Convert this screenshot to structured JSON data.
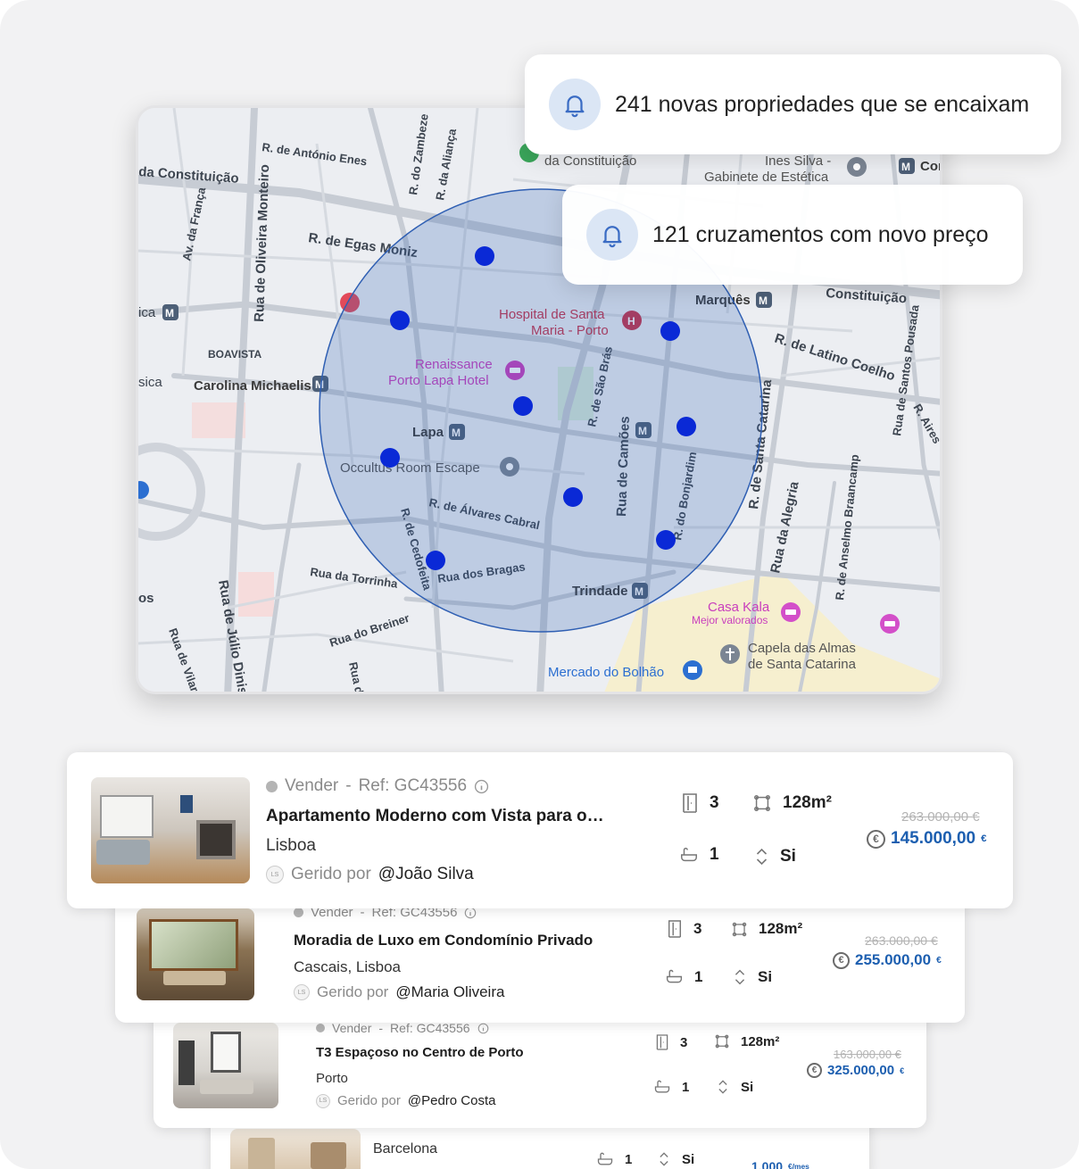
{
  "notifications": [
    {
      "icon": "bell-icon",
      "text": "241 novas propriedades que se encaixam"
    },
    {
      "icon": "bell-icon",
      "text": "121 cruzamentos com novo preço"
    }
  ],
  "map": {
    "streets": {
      "antonio_enes": "R. de António Enes",
      "zambeze": "R. do Zambeze",
      "alianca": "R. da Aliança",
      "constituicao_left": "da Constituição",
      "constituicao_top": "da Constituição",
      "constituicao_right": "Constituição",
      "egas_moniz": "R. de Egas Moniz",
      "franca": "Av. da França",
      "oliveira_monteiro": "Rua de Oliveira Monteiro",
      "boavista": "BOAVISTA",
      "latino_coelho": "R. de Latino Coelho",
      "santos_pousada": "Rua de Santos Pousada",
      "aires": "R. Aires",
      "sao_bras": "R. de São Brás",
      "camoes": "Rua de Camões",
      "bonjardim": "R. do Bonjardim",
      "santa_catarina": "R. de Santa Catarina",
      "alvares_cabral": "R. de Álvares Cabral",
      "cedofeita": "R. de Cedofeita",
      "bragas": "Rua dos Bragas",
      "torrinha": "Rua da Torrinha",
      "breiner": "Rua do Breiner",
      "julio_dinis": "Rua de Júlio Dinis",
      "vilar": "Rua de Vilar",
      "alegria": "Rua da Alegria",
      "anselmo": "R. de Anselmo Braancamp",
      "breiner2": "Rua do",
      "sica": "sica",
      "ica": "ica",
      "os": "os"
    },
    "places": {
      "hospital": "Hospital de Santa",
      "hospital2": "Maria - Porto",
      "renaissance": "Renaissance",
      "renaissance2": "Porto Lapa Hotel",
      "carolina": "Carolina Michaelis",
      "lapa": "Lapa",
      "occultus": "Occultus Room Escape",
      "trindade": "Trindade",
      "marques": "Marquês",
      "ines": "Ines Silva -",
      "ines2": "Gabinete de Estética",
      "casa_kala": "Casa Kala",
      "casa_kala_sub": "Mejor valorados",
      "capela": "Capela das Almas",
      "capela2": "de Santa Catarina",
      "mercado": "Mercado do Bolhão",
      "con": "Con"
    },
    "search_radius_color": "#2f5fb3",
    "pin_color": "#0a29d6"
  },
  "listings": [
    {
      "status": "Vender",
      "sep": "-",
      "ref": "Ref: GC43556",
      "title": "Apartamento Moderno com Vista para o…",
      "location": "Lisboa",
      "managed_label": "Gerido por",
      "manager": "@João Silva",
      "initials": "LS",
      "rooms": "3",
      "area": "128m²",
      "baths": "1",
      "elevator": "Si",
      "old_price": "263.000,00 €",
      "price": "145.000,00",
      "currency": "€"
    },
    {
      "status": "Vender",
      "sep": "-",
      "ref": "Ref: GC43556",
      "title": "Moradia de Luxo em Condomínio Privado",
      "location": "Cascais, Lisboa",
      "managed_label": "Gerido por",
      "manager": "@Maria Oliveira",
      "initials": "LS",
      "rooms": "3",
      "area": "128m²",
      "baths": "1",
      "elevator": "Si",
      "old_price": "263.000,00 €",
      "price": "255.000,00",
      "currency": "€"
    },
    {
      "status": "Vender",
      "sep": "-",
      "ref": "Ref: GC43556",
      "title": "T3 Espaçoso no Centro de Porto",
      "location": "Porto",
      "managed_label": "Gerido por",
      "manager": "@Pedro Costa",
      "initials": "LS",
      "rooms": "3",
      "area": "128m²",
      "baths": "1",
      "elevator": "Si",
      "old_price": "163.000,00 €",
      "price": "325.000,00",
      "currency": "€"
    },
    {
      "location": "Barcelona",
      "baths": "1",
      "elevator": "Si",
      "price": "1.000",
      "price_unit": "€/mes"
    }
  ]
}
